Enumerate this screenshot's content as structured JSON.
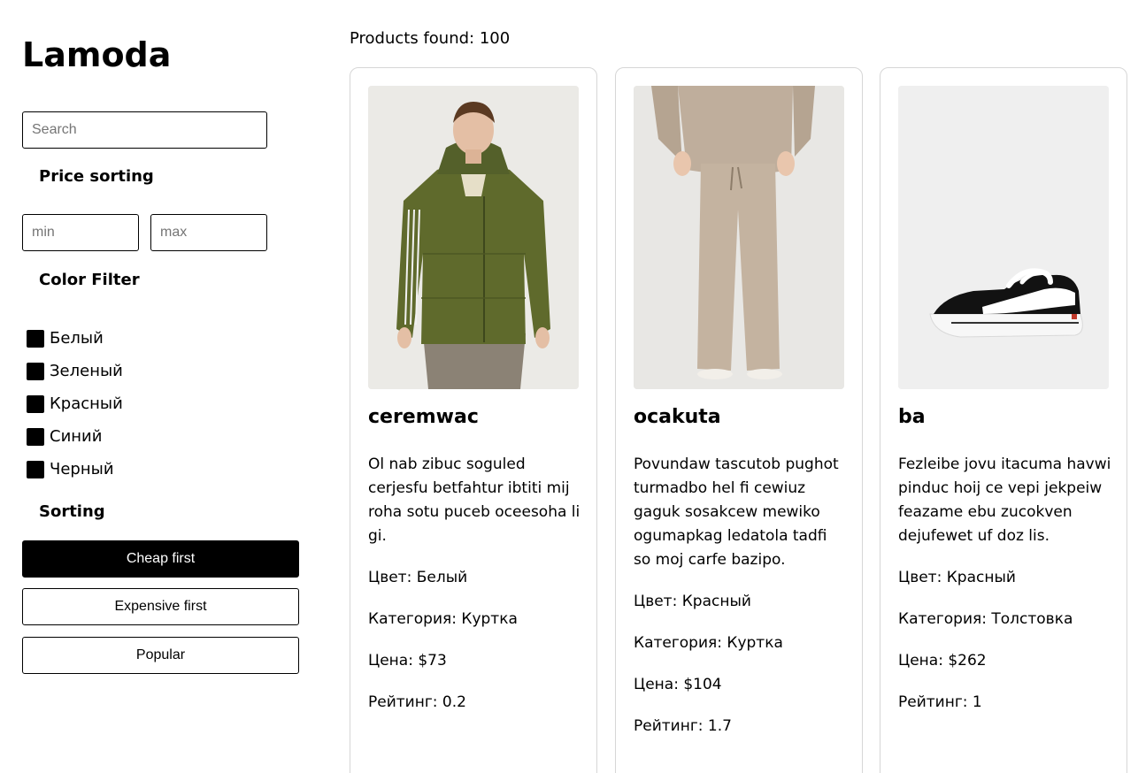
{
  "sidebar": {
    "logo": "Lamoda",
    "search_placeholder": "Search",
    "price_title": "Price sorting",
    "price_min_placeholder": "min",
    "price_max_placeholder": "max",
    "color_title": "Color Filter",
    "colors": [
      "Белый",
      "Зеленый",
      "Красный",
      "Синий",
      "Черный"
    ],
    "sorting_title": "Sorting",
    "sort_buttons": [
      "Cheap first",
      "Expensive first",
      "Popular"
    ]
  },
  "main": {
    "products_found": "Products found: 100",
    "products": [
      {
        "name": "ceremwac",
        "description": "Ol nab zibuc soguled cerjesfu betfahtur ibtiti mij roha sotu puceb oceesoha li gi.",
        "color": "Цвет: Белый",
        "category": "Категория: Куртка",
        "price": "Цена: $73",
        "rating": "Рейтинг: 0.2",
        "image": "green-puffer-jacket-photo"
      },
      {
        "name": "ocakuta",
        "description": "Povundaw tascutob pughot turmadbo hel fi cewiuz gaguk sosakcew mewiko ogumapkag ledatola tadfi so moj carfe bazipo.",
        "color": "Цвет: Красный",
        "category": "Категория: Куртка",
        "price": "Цена: $104",
        "rating": "Рейтинг: 1.7",
        "image": "beige-knit-pants-photo"
      },
      {
        "name": "ba",
        "description": "Fezleibe jovu itacuma havwi pinduc hoij ce vepi jekpeiw feazame ebu zucokven dejufewet uf doz lis.",
        "color": "Цвет: Красный",
        "category": "Категория: Толстовка",
        "price": "Цена: $262",
        "rating": "Рейтинг: 1",
        "image": "black-white-sneaker-photo"
      }
    ]
  }
}
